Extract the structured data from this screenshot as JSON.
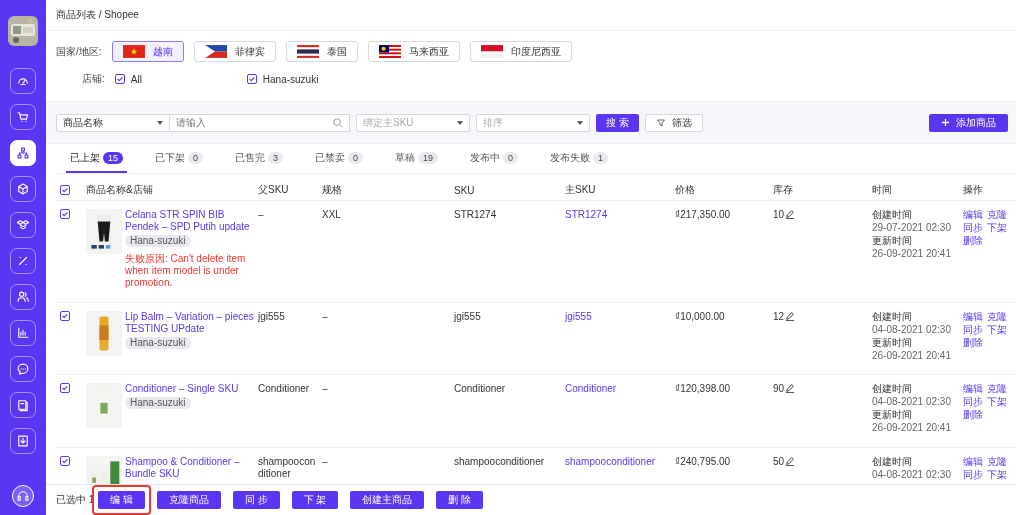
{
  "header": {
    "breadcrumb": "商品列表 / Shopee"
  },
  "sidebar": {
    "items": [
      {
        "selected": false
      },
      {
        "selected": false
      },
      {
        "selected": true
      },
      {
        "selected": false
      },
      {
        "selected": false
      },
      {
        "selected": false
      },
      {
        "selected": false
      },
      {
        "selected": false
      },
      {
        "selected": false
      },
      {
        "selected": false
      },
      {
        "selected": false
      }
    ]
  },
  "filters": {
    "country_label": "国家/地区:",
    "countries": [
      {
        "label": "越南",
        "selected": true
      },
      {
        "label": "菲律宾",
        "selected": false
      },
      {
        "label": "泰国",
        "selected": false
      },
      {
        "label": "马来西亚",
        "selected": false
      },
      {
        "label": "印度尼西亚",
        "selected": false
      }
    ],
    "shop_label": "店铺:",
    "shops": [
      {
        "label": "All",
        "checked": true
      },
      {
        "label": "Hana-suzuki",
        "checked": true
      }
    ]
  },
  "search": {
    "field_select": "商品名称",
    "placeholder": "请输入",
    "sku_placeholder": "绑定主SKU",
    "sort_placeholder": "排序",
    "search_button": "搜 索",
    "filter_button": "筛选",
    "add_button": "添加商品"
  },
  "tabs": [
    {
      "label": "已上架",
      "count": "15",
      "selected": true
    },
    {
      "label": "已下架",
      "count": "0",
      "selected": false
    },
    {
      "label": "已售完",
      "count": "3",
      "selected": false
    },
    {
      "label": "已禁卖",
      "count": "0",
      "selected": false
    },
    {
      "label": "草稿",
      "count": "19",
      "selected": false
    },
    {
      "label": "发布中",
      "count": "0",
      "selected": false
    },
    {
      "label": "发布失败",
      "count": "1",
      "selected": false
    }
  ],
  "table": {
    "all_checked": true,
    "columns": [
      "商品名称&店铺",
      "父SKU",
      "规格",
      "SKU",
      "主SKU",
      "价格",
      "库存",
      "时间",
      "操作"
    ],
    "rows": [
      {
        "checked": true,
        "image": {
          "kind": "picture"
        },
        "name": "Celana STR SPIN BIB Pendek – SPD Putih update",
        "shop": "Hana-suzuki",
        "error": "失败原因: Can't delete item when item model is under promotion.",
        "parent_sku": "–",
        "spec": "XXL",
        "sku": "STR1274",
        "main_sku": "STR1274",
        "price": "₫217,350.00",
        "stock": "10",
        "created_label": "创建时间",
        "created": "29-07-2021 02:30",
        "updated_label": "更新时间",
        "updated": "26-09-2021 20:41",
        "actions": [
          "编辑",
          "克隆",
          "同步",
          "下架",
          "删除"
        ]
      },
      {
        "checked": true,
        "image": {
          "kind": "picture"
        },
        "name": "Lip Balm – Variation – pieces TESTING UPdate",
        "shop": "Hana-suzuki",
        "parent_sku": "jgi555",
        "spec": "–",
        "sku": "jgi555",
        "main_sku": "jgi555",
        "price": "₫10,000.00",
        "stock": "12",
        "created_label": "创建时间",
        "created": "04-08-2021 02:30",
        "updated_label": "更新时间",
        "updated": "26-09-2021 20:41",
        "actions": [
          "编辑",
          "克隆",
          "同步",
          "下架",
          "删除"
        ]
      },
      {
        "checked": true,
        "image": {
          "kind": "picture"
        },
        "name": "Conditioner – Single SKU",
        "shop": "Hana-suzuki",
        "parent_sku": "Conditioner",
        "spec": "–",
        "sku": "Conditioner",
        "main_sku": "Conditioner",
        "price": "₫120,398.00",
        "stock": "90",
        "created_label": "创建时间",
        "created": "04-08-2021 02:30",
        "updated_label": "更新时间",
        "updated": "26-09-2021 20:41",
        "actions": [
          "编辑",
          "克隆",
          "同步",
          "下架",
          "删除"
        ]
      },
      {
        "checked": true,
        "image": {
          "kind": "picture"
        },
        "name": "Shampoo & Conditioner – Bundle SKU",
        "parent_sku": "shampooconditioner",
        "spec": "–",
        "sku": "shampooconditioner",
        "main_sku": "shampooconditioner",
        "price": "₫240,795.00",
        "stock": "50",
        "created_label": "创建时间",
        "created": "04-08-2021 02:30",
        "actions": [
          "编辑",
          "克隆",
          "同步",
          "下架"
        ]
      }
    ]
  },
  "bottom_bar": {
    "selected_text": "已选中 1",
    "buttons": [
      {
        "label": "编 辑",
        "highlighted": true
      },
      {
        "label": "克隆商品",
        "highlighted": false
      },
      {
        "label": "同 步",
        "highlighted": false
      },
      {
        "label": "下 架",
        "highlighted": false
      },
      {
        "label": "创建主商品",
        "highlighted": false
      },
      {
        "label": "删 除",
        "highlighted": false
      }
    ]
  }
}
